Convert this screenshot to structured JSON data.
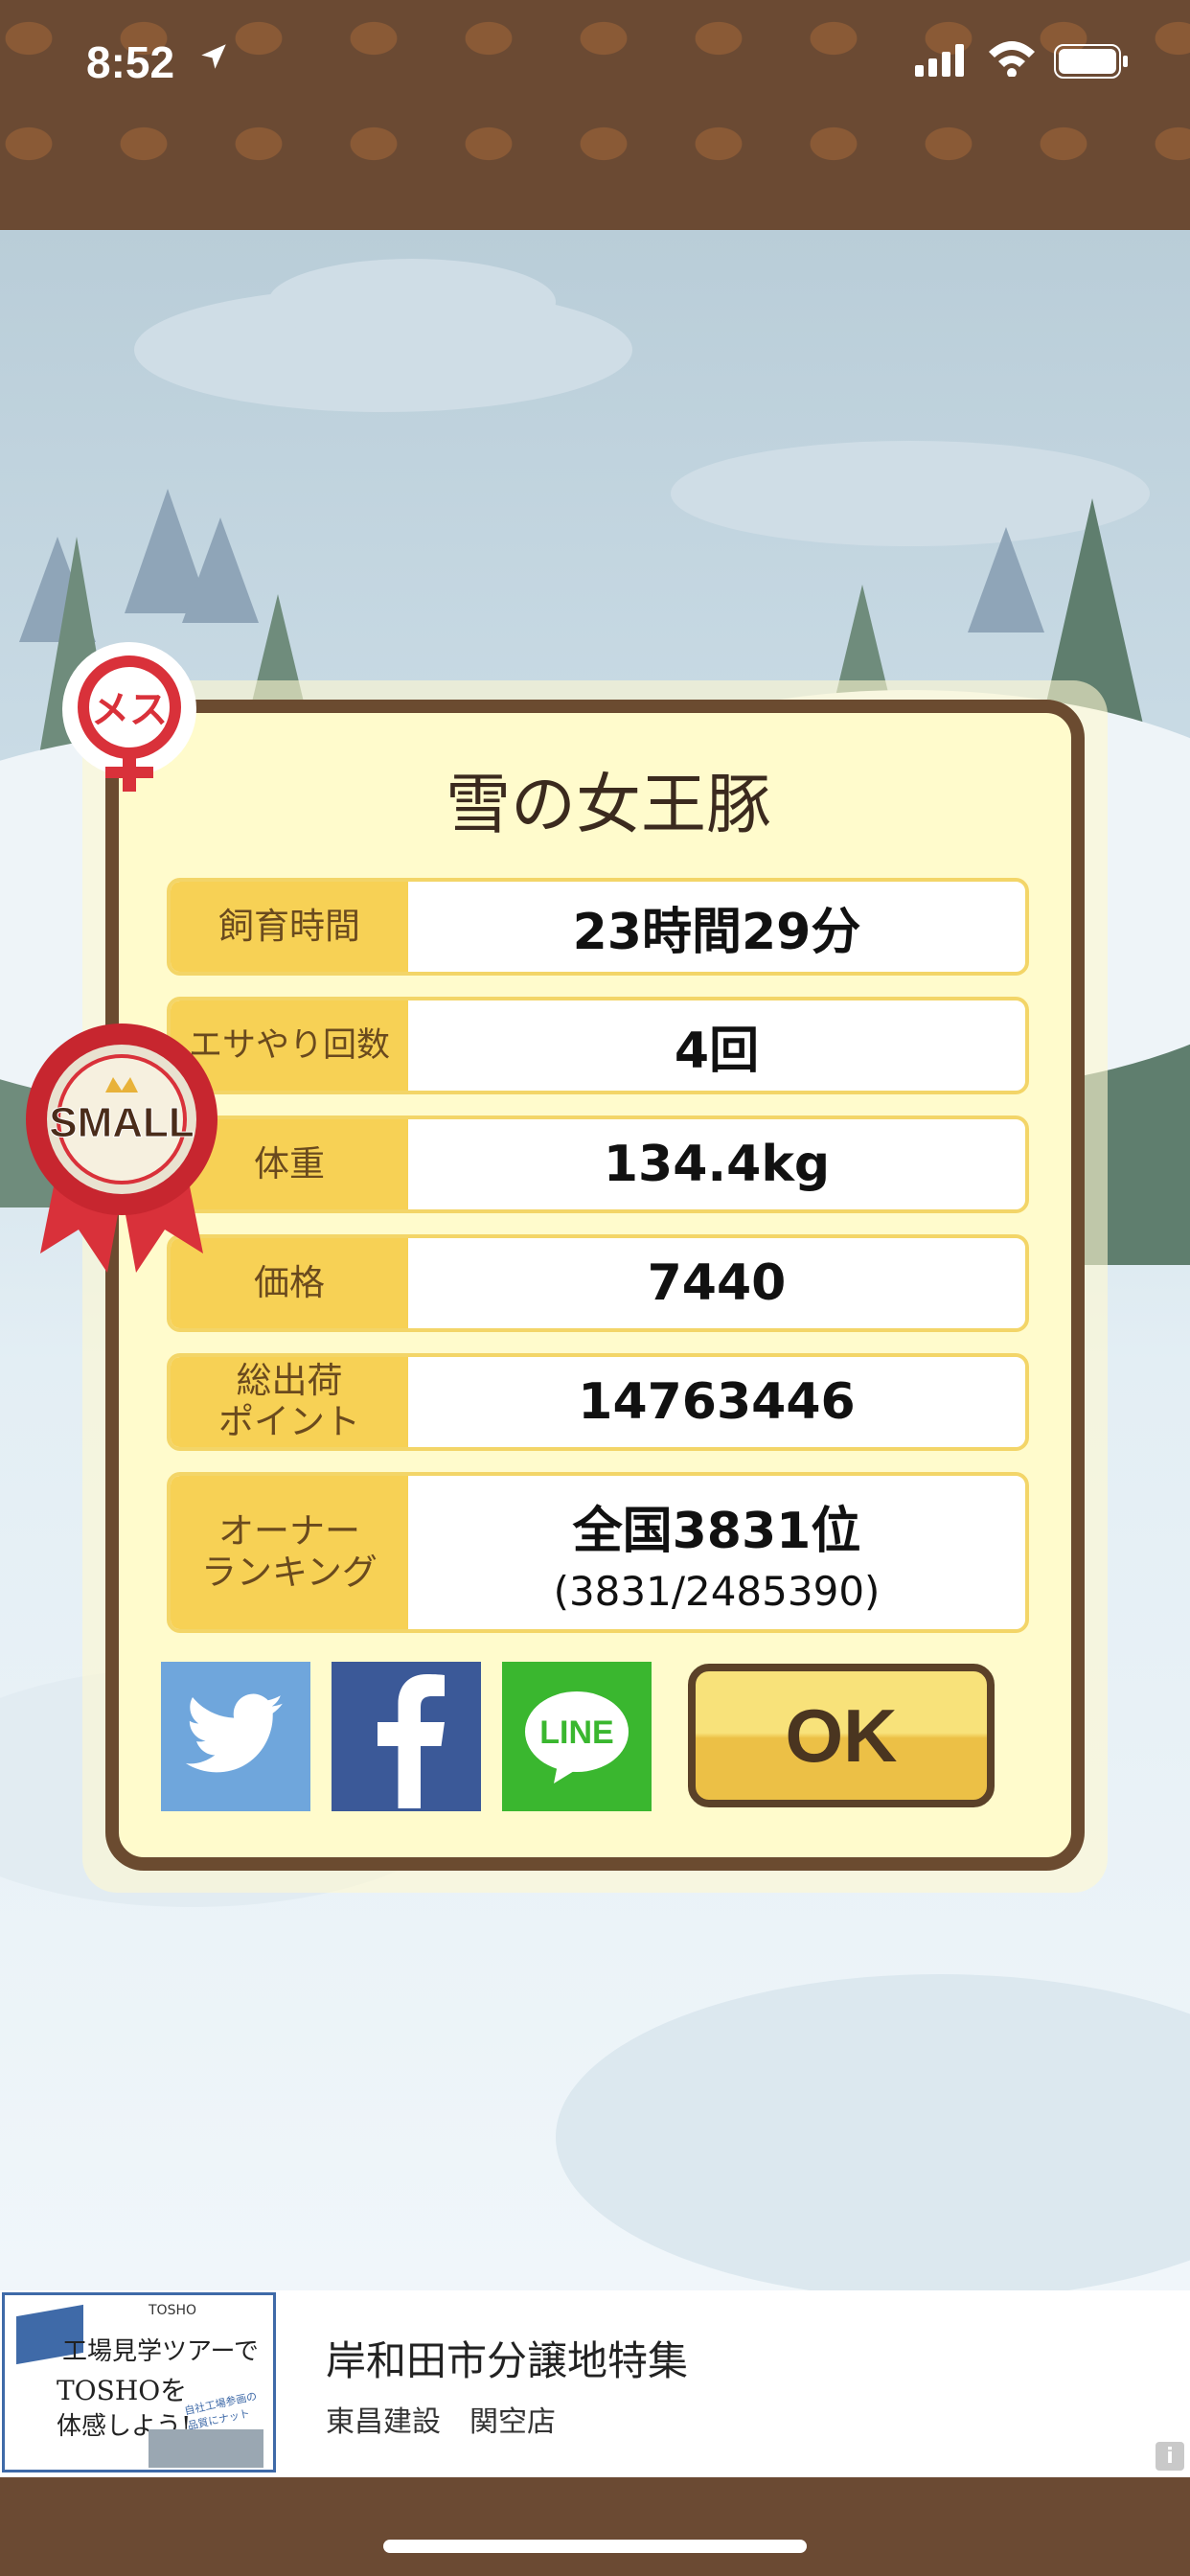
{
  "status_bar": {
    "time": "8:52"
  },
  "dialog": {
    "title": "雪の女王豚",
    "rows": [
      {
        "label": "飼育時間",
        "value": "23時間29分"
      },
      {
        "label": "エサやり回数",
        "value": "4回"
      },
      {
        "label": "体重",
        "value": "134.4kg"
      },
      {
        "label": "価格",
        "value": "7440"
      },
      {
        "label": "総出荷\nポイント",
        "value": "14763446"
      },
      {
        "label": "オーナー\nランキング",
        "value": "全国3831位",
        "sub": "(3831/2485390)"
      }
    ],
    "ok_label": "OK",
    "share": [
      "twitter-icon",
      "facebook-icon",
      "line-icon"
    ],
    "line_text": "LINE"
  },
  "badges": {
    "female_text": "メス",
    "size_text": "SMALL"
  },
  "ad": {
    "thumb_lines": [
      "TOSHO",
      "工場見学ツアーで",
      "TOSHOを",
      "体感しよう!",
      "自社工場参画の品質にナットク!"
    ],
    "title": "岸和田市分譲地特集",
    "subtitle": "東昌建設　関空店",
    "info_icon": "i"
  },
  "colors": {
    "brown": "#6b4b30",
    "yellow": "#f7d155",
    "twitter": "#6fa6dc",
    "facebook": "#3b5998",
    "line": "#3ab72f"
  }
}
